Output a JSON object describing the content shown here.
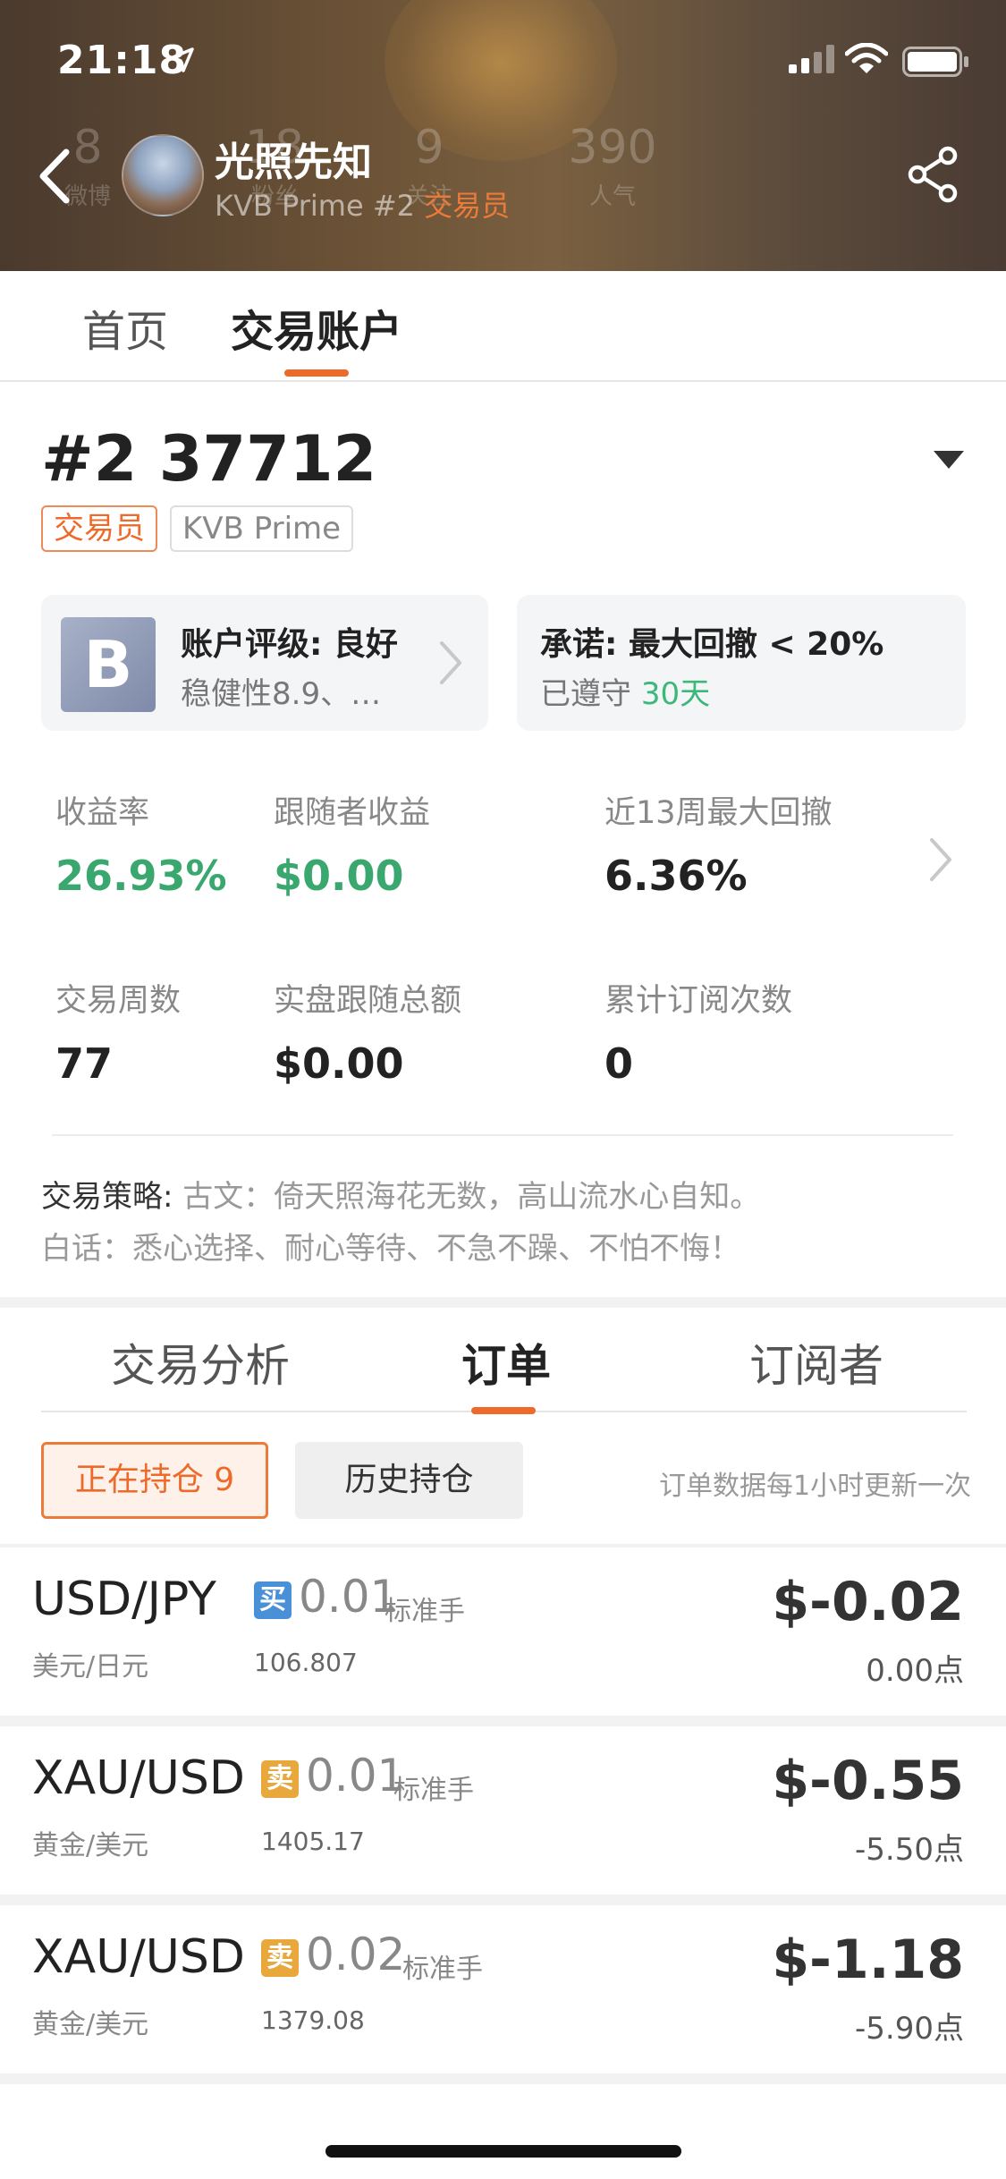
{
  "status_bar": {
    "time": "21:18"
  },
  "header": {
    "background_stats": [
      {
        "num": "8",
        "label": "微博"
      },
      {
        "num": "18",
        "label": "粉丝"
      },
      {
        "num": "9",
        "label": "关注"
      },
      {
        "num": "390",
        "label": "人气"
      }
    ],
    "name": "光照先知",
    "sub_prefix": "KVB Prime #2 ",
    "sub_role": "交易员"
  },
  "top_tabs": [
    {
      "label": "首页"
    },
    {
      "label": "交易账户"
    }
  ],
  "account": {
    "number": "#2  37712",
    "tags": [
      "交易员",
      "KVB Prime"
    ]
  },
  "rating_card": {
    "badge": "B",
    "title": "账户评级: 良好",
    "sub": "稳健性8.9、…"
  },
  "promise_card": {
    "title": "承诺: 最大回撤 < 20%",
    "sub_prefix": "已遵守 ",
    "sub_days": "30天"
  },
  "stats": [
    {
      "label": "收益率",
      "value": "26.93%"
    },
    {
      "label": "跟随者收益",
      "value": "$0.00"
    },
    {
      "label": "近13周最大回撤",
      "value": "6.36%"
    },
    {
      "label": "交易周数",
      "value": "77"
    },
    {
      "label": "实盘跟随总额",
      "value": "$0.00"
    },
    {
      "label": "累计订阅次数",
      "value": "0"
    }
  ],
  "strategy": {
    "key": "交易策略:",
    "line1": " 古文：倚天照海花无数，高山流水心自知。",
    "line2": "白话：悉心选择、耐心等待、不急不躁、不怕不悔！"
  },
  "sub_tabs": [
    {
      "label": "交易分析"
    },
    {
      "label": "订单"
    },
    {
      "label": "订阅者"
    }
  ],
  "orders_toolbar": {
    "open_label": "正在持仓 9",
    "history_label": "历史持仓",
    "note": "订单数据每1小时更新一次"
  },
  "orders": [
    {
      "pair": "USD/JPY",
      "pair_cn": "美元/日元",
      "side": "买",
      "lots": "0.01",
      "unit": "标准手",
      "price": "106.807",
      "pnl": "$-0.02",
      "points": "0.00点"
    },
    {
      "pair": "XAU/USD",
      "pair_cn": "黄金/美元",
      "side": "卖",
      "lots": "0.01",
      "unit": "标准手",
      "price": "1405.17",
      "pnl": "$-0.55",
      "points": "-5.50点"
    },
    {
      "pair": "XAU/USD",
      "pair_cn": "黄金/美元",
      "side": "卖",
      "lots": "0.02",
      "unit": "标准手",
      "price": "1379.08",
      "pnl": "$-1.18",
      "points": "-5.90点"
    }
  ],
  "colors": {
    "accent": "#ee6a2b",
    "positive": "#3aa86e",
    "buy": "#4a90d6",
    "sell": "#e8a83c"
  },
  "icons": [
    "location-arrow-icon",
    "signal-icon",
    "wifi-icon",
    "battery-icon",
    "back-icon",
    "share-icon",
    "caret-down-icon",
    "chevron-right-icon"
  ]
}
